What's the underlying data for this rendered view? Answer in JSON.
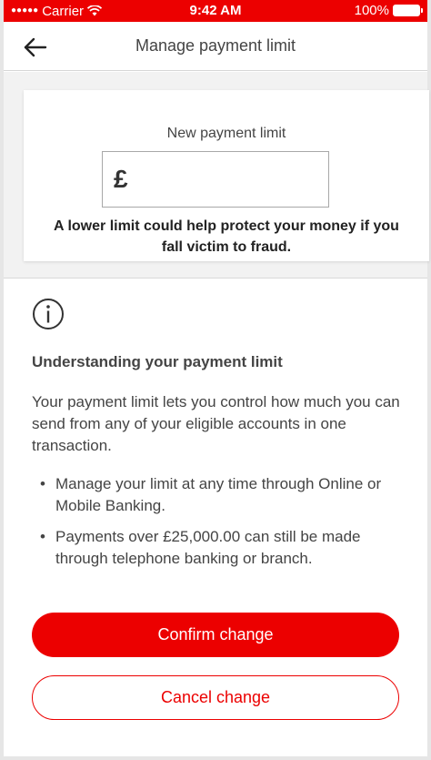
{
  "status_bar": {
    "signal_dots": "●●●●●",
    "carrier": "Carrier",
    "time": "9:42 AM",
    "battery": "100%"
  },
  "nav": {
    "back_icon": "back-arrow-icon",
    "title": "Manage payment limit"
  },
  "limit_card": {
    "label": "New payment limit",
    "currency_symbol": "£",
    "amount_value": "",
    "warning": "A lower limit could help protect your money if you fall victim to fraud."
  },
  "info": {
    "icon": "info-icon",
    "heading": "Understanding your payment limit",
    "body": "Your payment limit lets you control how much you can send from any of your eligible accounts in one transaction.",
    "bullets": [
      "Manage your limit at any time through Online or Mobile Banking.",
      "Payments over £25,000.00 can still be made through telephone banking or branch."
    ]
  },
  "actions": {
    "confirm_label": "Confirm change",
    "cancel_label": "Cancel change"
  },
  "colors": {
    "brand_red": "#ec0000",
    "background_grey": "#f2f2f2"
  }
}
